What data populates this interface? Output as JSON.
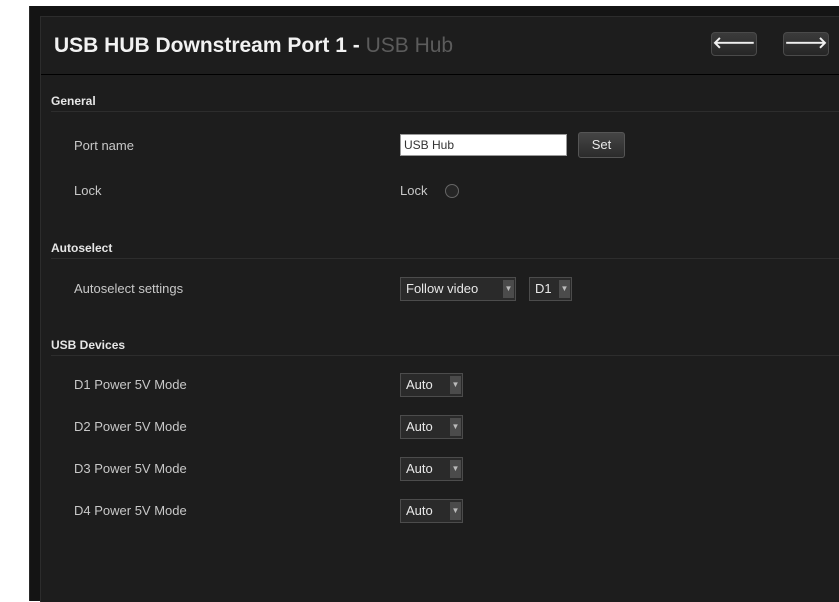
{
  "header": {
    "title": "USB HUB Downstream Port 1",
    "separator": " - ",
    "subtitle": "USB Hub",
    "prev_glyph": "🡐",
    "next_glyph": "🡒"
  },
  "general": {
    "heading": "General",
    "port_name_label": "Port name",
    "port_name_value": "USB Hub",
    "set_button": "Set",
    "lock_label": "Lock",
    "lock_text": "Lock"
  },
  "autoselect": {
    "heading": "Autoselect",
    "settings_label": "Autoselect settings",
    "mode_value": "Follow video",
    "source_value": "D1"
  },
  "usb_devices": {
    "heading": "USB Devices",
    "rows": [
      {
        "label": "D1 Power 5V Mode",
        "value": "Auto"
      },
      {
        "label": "D2 Power 5V Mode",
        "value": "Auto"
      },
      {
        "label": "D3 Power 5V Mode",
        "value": "Auto"
      },
      {
        "label": "D4 Power 5V Mode",
        "value": "Auto"
      }
    ]
  },
  "icons": {
    "prev": "arrow-left-icon",
    "next": "arrow-right-icon",
    "dropdown": "chevron-down-icon"
  },
  "colors": {
    "background": "#1d1d1d",
    "title_text": "#f2f2f2",
    "subtitle_text": "#5c5c5c",
    "label_text": "#c8c8c8"
  }
}
